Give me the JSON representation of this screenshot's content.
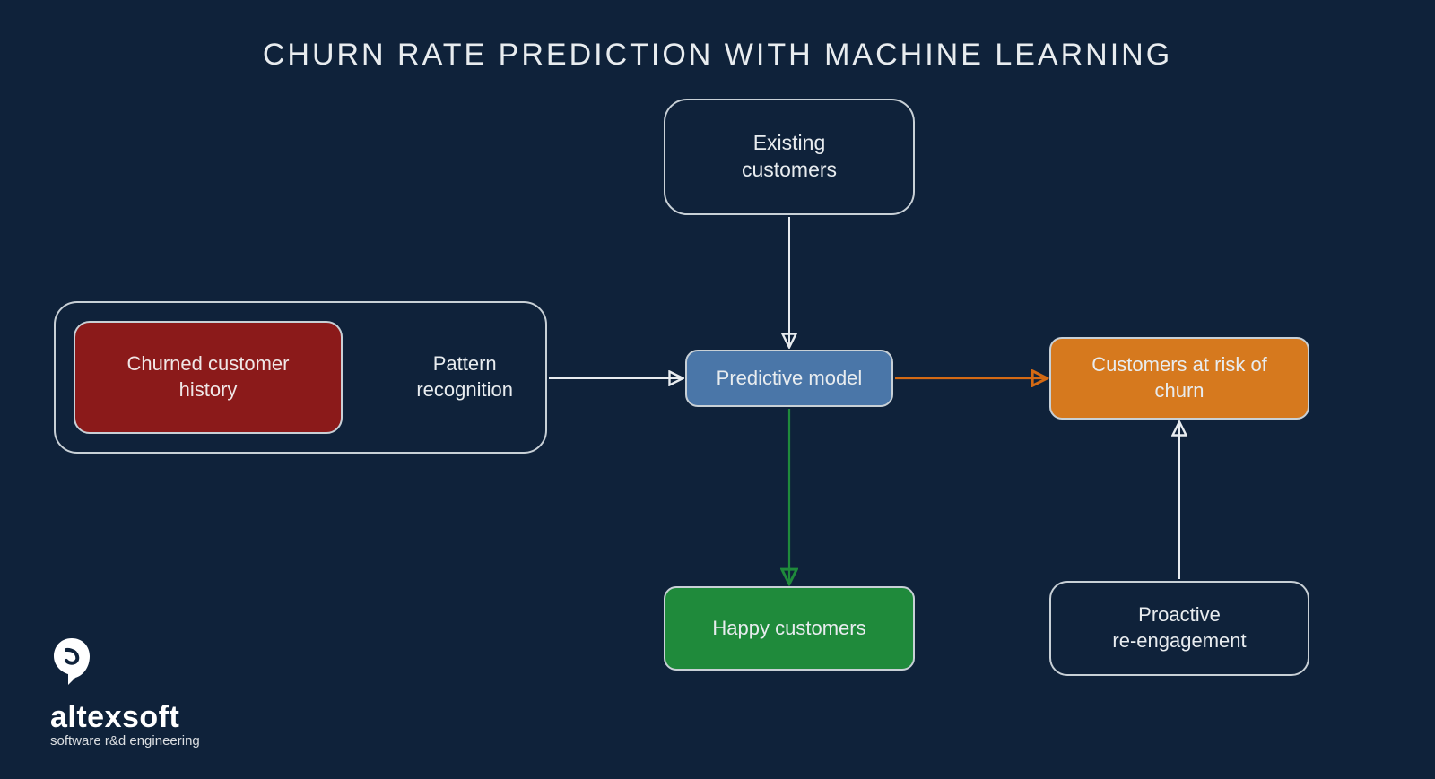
{
  "title": "CHURN RATE PREDICTION WITH MACHINE LEARNING",
  "nodes": {
    "existing_customers": "Existing\ncustomers",
    "churned_history": "Churned customer\nhistory",
    "pattern_recognition": "Pattern\nrecognition",
    "predictive_model": "Predictive model",
    "customers_at_risk": "Customers at risk of\nchurn",
    "happy_customers": "Happy customers",
    "proactive_reengagement": "Proactive\nre-engagement"
  },
  "brand": {
    "name": "altexsoft",
    "tagline": "software r&d engineering"
  },
  "diagram": {
    "edges": [
      {
        "from": "existing_customers",
        "to": "predictive_model",
        "color": "white"
      },
      {
        "from": "pattern_recognition",
        "to": "predictive_model",
        "color": "white"
      },
      {
        "from": "predictive_model",
        "to": "customers_at_risk",
        "color": "orange"
      },
      {
        "from": "predictive_model",
        "to": "happy_customers",
        "color": "green"
      },
      {
        "from": "proactive_reengagement",
        "to": "customers_at_risk",
        "color": "white"
      }
    ]
  },
  "colors": {
    "bg": "#0f223a",
    "outline": "#c8d0d6",
    "red": "#8b1a1a",
    "blue": "#4a76a8",
    "green": "#1f8a3b",
    "orange": "#d6791e",
    "arrow_white": "#e8ecef",
    "arrow_orange": "#d46a14",
    "arrow_green": "#1f8a3b"
  }
}
